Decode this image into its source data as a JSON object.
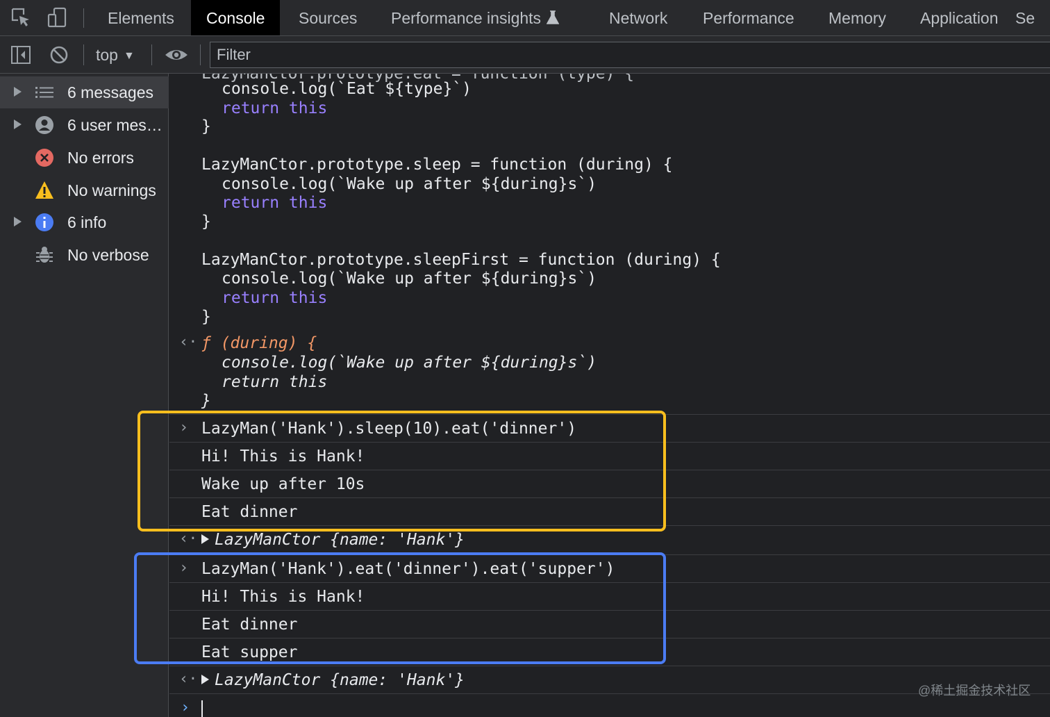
{
  "tabs": [
    {
      "label": "Elements",
      "active": false
    },
    {
      "label": "Console",
      "active": true
    },
    {
      "label": "Sources",
      "active": false
    },
    {
      "label": "Performance insights",
      "active": false
    },
    {
      "label": "Network",
      "active": false
    },
    {
      "label": "Performance",
      "active": false
    },
    {
      "label": "Memory",
      "active": false
    },
    {
      "label": "Application",
      "active": false
    },
    {
      "label": "Se",
      "active": false
    }
  ],
  "toolbar": {
    "context": "top",
    "filter_placeholder": "Filter"
  },
  "sidebar": {
    "items": [
      {
        "label": "6 messages",
        "icon": "list-icon",
        "expandable": true,
        "selected": true
      },
      {
        "label": "6 user mes…",
        "icon": "user-icon",
        "expandable": true,
        "selected": false
      },
      {
        "label": "No errors",
        "icon": "error-icon",
        "expandable": false,
        "selected": false
      },
      {
        "label": "No warnings",
        "icon": "warning-icon",
        "expandable": false,
        "selected": false
      },
      {
        "label": "6 info",
        "icon": "info-icon",
        "expandable": true,
        "selected": false
      },
      {
        "label": "No verbose",
        "icon": "bug-icon",
        "expandable": false,
        "selected": false
      }
    ]
  },
  "console": {
    "top_code": [
      "LazyManCtor.prototype.eat = function (type) {",
      "console.log(`Eat ${type}`)",
      "return this",
      "}",
      "LazyManCtor.prototype.sleep = function (during) {",
      "console.log(`Wake up after ${during}s`)",
      "return this",
      "}",
      "LazyManCtor.prototype.sleepFirst = function (during) {",
      "console.log(`Wake up after ${during}s`)",
      "return this",
      "}"
    ],
    "return_fn": [
      "ƒ (during) {",
      "console.log(`Wake up after ${during}s`)",
      "return this",
      "}"
    ],
    "call1": {
      "input": "LazyMan('Hank').sleep(10).eat('dinner')",
      "outputs": [
        "Hi! This is Hank!",
        "Wake up after 10s",
        "Eat dinner"
      ],
      "result": "LazyManCtor {name: 'Hank'}"
    },
    "call2": {
      "input": "LazyMan('Hank').eat('dinner').eat('supper')",
      "outputs": [
        "Hi! This is Hank!",
        "Eat dinner",
        "Eat supper"
      ],
      "result": "LazyManCtor {name: 'Hank'}"
    }
  },
  "colors": {
    "highlight_yellow": "#f9be1e",
    "highlight_blue": "#4b7cf3"
  },
  "watermark": "@稀土掘金技术社区"
}
